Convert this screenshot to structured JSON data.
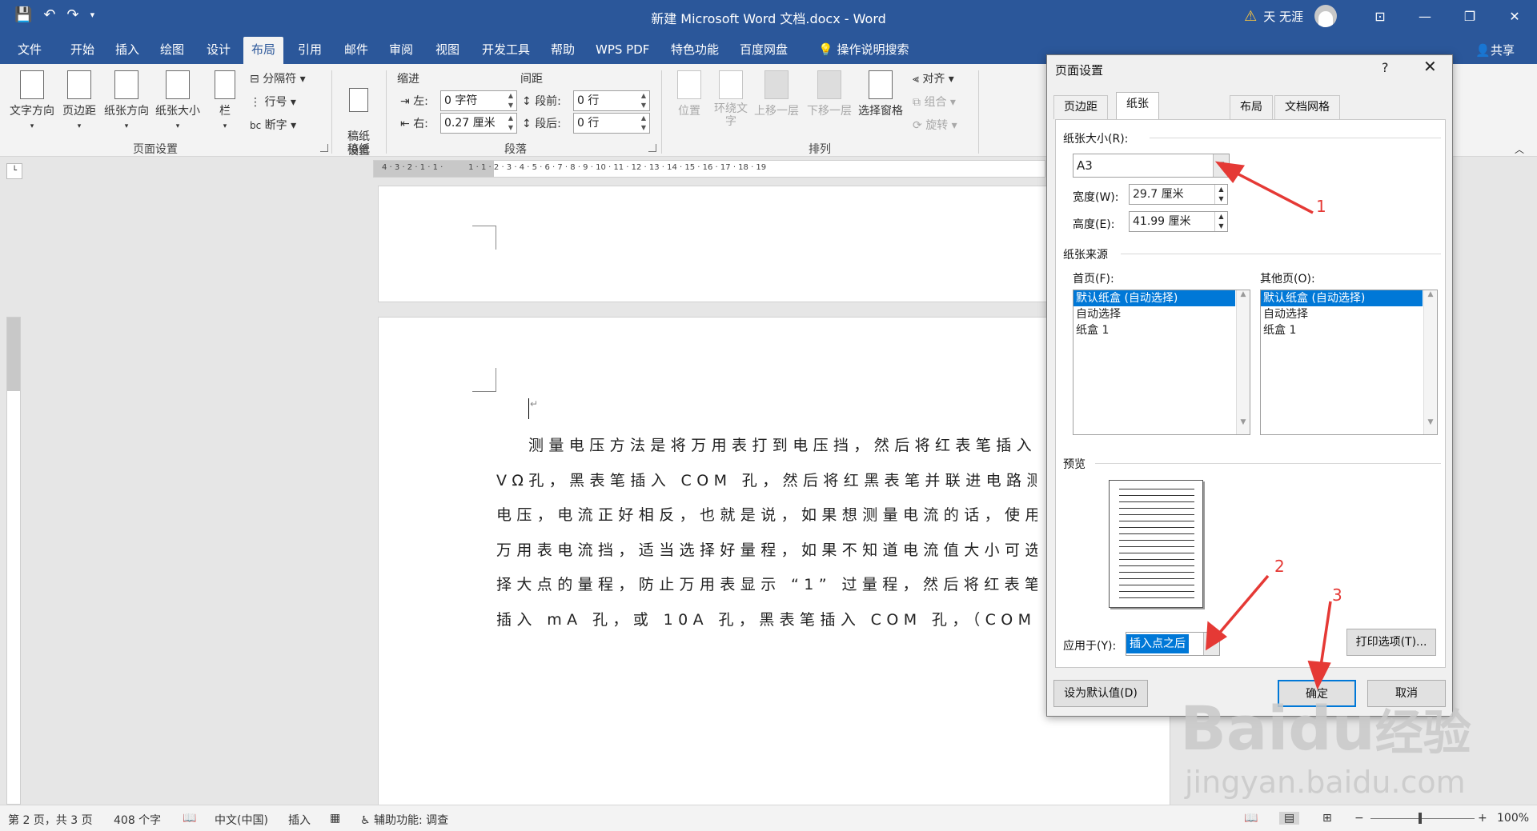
{
  "window": {
    "title": "新建 Microsoft Word 文档.docx - Word",
    "user": "天 无涯",
    "warning_icon": "warning-icon"
  },
  "qat": {
    "save_icon": "save-icon",
    "undo_icon": "undo-icon",
    "redo_icon": "redo-icon"
  },
  "tabs": [
    "文件",
    "开始",
    "插入",
    "绘图",
    "设计",
    "布局",
    "引用",
    "邮件",
    "审阅",
    "视图",
    "开发工具",
    "帮助",
    "WPS PDF",
    "特色功能",
    "百度网盘",
    "操作说明搜索"
  ],
  "active_tab": "布局",
  "share_label": "共享",
  "ribbon": {
    "page_setup": {
      "text_direction": "文字方向",
      "margins": "页边距",
      "orientation": "纸张方向",
      "size": "纸张大小",
      "columns": "栏",
      "breaks": "分隔符",
      "line_numbers": "行号",
      "hyphenation": "断字",
      "label": "页面设置"
    },
    "manuscript": {
      "button": "稿纸\n设置",
      "label": "稿纸"
    },
    "paragraph": {
      "indent_title": "缩进",
      "spacing_title": "间距",
      "left_label": "左:",
      "left_value": "0 字符",
      "right_label": "右:",
      "right_value": "0.27 厘米",
      "before_label": "段前:",
      "before_value": "0 行",
      "after_label": "段后:",
      "after_value": "0 行",
      "label": "段落"
    },
    "arrange": {
      "position": "位置",
      "wrap_text": "环绕文字",
      "bring_forward": "上移一层",
      "send_backward": "下移一层",
      "selection_pane": "选择窗格",
      "align": "对齐",
      "group": "组合",
      "rotate": "旋转",
      "label": "排列"
    }
  },
  "document": {
    "cursor_mark": "↵",
    "paragraph_lines": [
      "测量电压方法是将万用表打到电压挡，然后将红表笔插入",
      "VΩ孔，黑表笔插入 COM 孔，然后将红黑表笔并联进电路测量",
      "电压，电流正好相反，也就是说，如果想测量电流的话，使用",
      "万用表电流挡，适当选择好量程，如果不知道电流值大小可选",
      "择大点的量程，防止万用表显示 “1” 过量程，然后将红表笔",
      "插入 mA 孔，或 10A 孔，黑表笔插入 COM 孔，（COM 孔称为"
    ]
  },
  "status": {
    "page": "第 2 页，共 3 页",
    "words": "408 个字",
    "language": "中文(中国)",
    "mode": "插入",
    "accessibility": "辅助功能: 调查",
    "zoom": "100%",
    "zoom_fraction": 0.5
  },
  "dialog": {
    "title": "页面设置",
    "help": "?",
    "close": "✕",
    "tabs": [
      "页边距",
      "纸张",
      "布局",
      "文档网格"
    ],
    "active_tab": "纸张",
    "paper_size_label": "纸张大小(R):",
    "paper_size_value": "A3",
    "width_label": "宽度(W):",
    "width_value": "29.7 厘米",
    "height_label": "高度(E):",
    "height_value": "41.99 厘米",
    "paper_source_label": "纸张来源",
    "first_page_label": "首页(F):",
    "other_pages_label": "其他页(O):",
    "first_page_items": [
      "默认纸盒 (自动选择)",
      "自动选择",
      "纸盒 1"
    ],
    "other_pages_items": [
      "默认纸盒 (自动选择)",
      "自动选择",
      "纸盒 1"
    ],
    "preview_label": "预览",
    "apply_to_label": "应用于(Y):",
    "apply_to_value": "插入点之后",
    "print_options": "打印选项(T)...",
    "set_default": "设为默认值(D)",
    "ok": "确定",
    "cancel": "取消"
  },
  "annotations": {
    "n1": "1",
    "n2": "2",
    "n3": "3",
    "arrow_color": "#e53935"
  },
  "watermark": {
    "brand": "Baidu",
    "cn": "经验",
    "url": "jingyan.baidu.com"
  }
}
